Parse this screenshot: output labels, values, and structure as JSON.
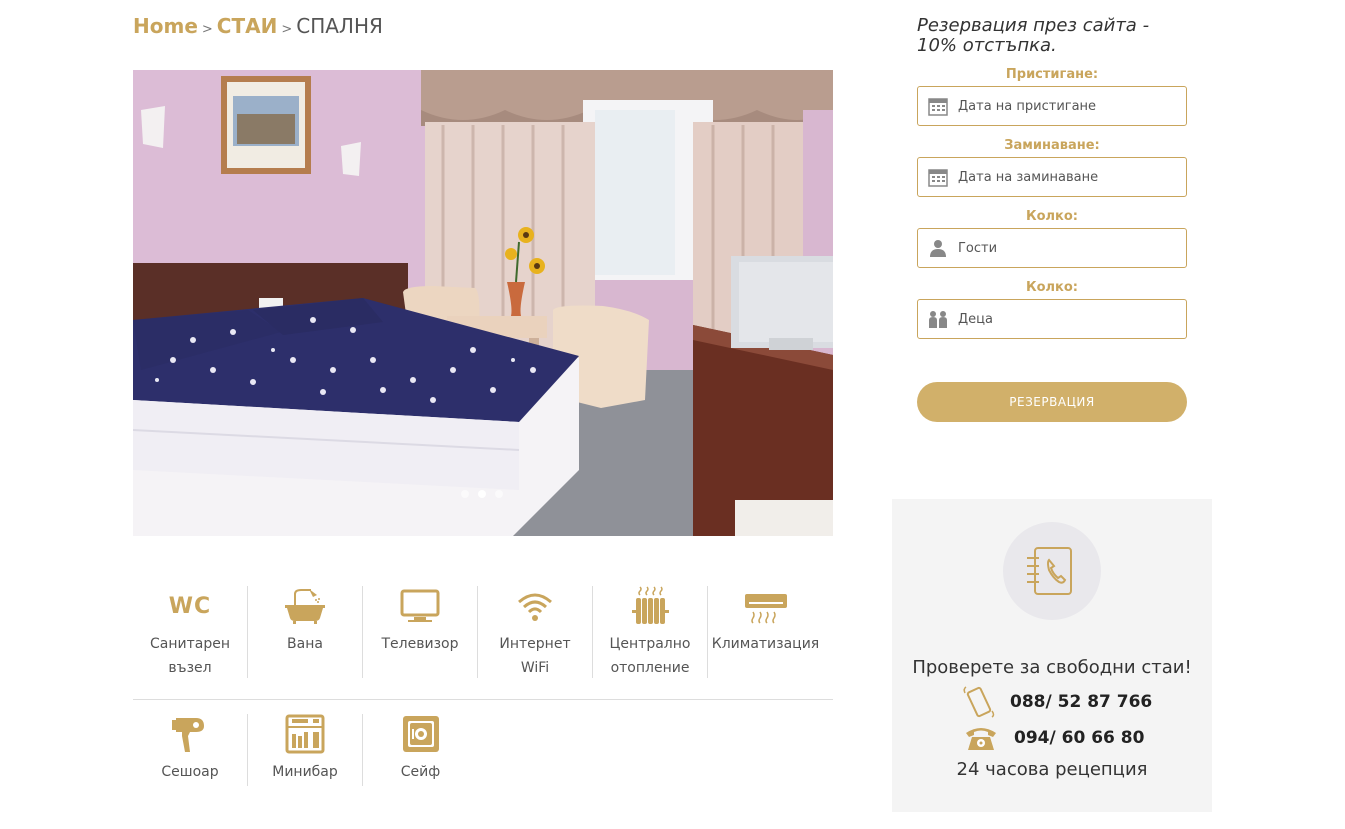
{
  "breadcrumb": {
    "home": "Home",
    "rooms": "СТАИ",
    "current": "СПАЛНЯ",
    "separator": ">"
  },
  "gallery": {
    "slides": 3,
    "active_slide": 1
  },
  "amenities": [
    {
      "icon": "wc-icon",
      "line1": "Санитарен",
      "line2": "възел"
    },
    {
      "icon": "bathtub-icon",
      "line1": "Вана",
      "line2": ""
    },
    {
      "icon": "tv-icon",
      "line1": "Телевизор",
      "line2": ""
    },
    {
      "icon": "wifi-icon",
      "line1": "Интернет",
      "line2": "WiFi"
    },
    {
      "icon": "radiator-icon",
      "line1": "Централно",
      "line2": "отопление"
    },
    {
      "icon": "air-conditioner-icon",
      "line1": "Климатизация",
      "line2": ""
    },
    {
      "icon": "hair-dryer-icon",
      "line1": "Сешоар",
      "line2": ""
    },
    {
      "icon": "minibar-icon",
      "line1": "Минибар",
      "line2": ""
    },
    {
      "icon": "safe-icon",
      "line1": "Сейф",
      "line2": ""
    }
  ],
  "amenity_text": {
    "wc": "WC"
  },
  "booking": {
    "title": "Резервация през сайта - 10% отстъпка.",
    "arrival_label": "Пристигане:",
    "arrival_placeholder": "Дата на пристигане",
    "departure_label": "Заминаване:",
    "departure_placeholder": "Дата на заминаване",
    "guests_label": "Колко:",
    "guests_placeholder": "Гости",
    "children_label": "Колко:",
    "children_placeholder": "Деца",
    "button": "РЕЗЕРВАЦИЯ"
  },
  "contact": {
    "title": "Проверете за свободни стаи!",
    "mobile": "088/ 52 87 766",
    "landline": "094/ 60 66 80",
    "reception": "24 часова рецепция"
  },
  "colors": {
    "accent": "#c9a55c",
    "button": "#d1b06a",
    "contact_bg": "#f4f4f4"
  }
}
